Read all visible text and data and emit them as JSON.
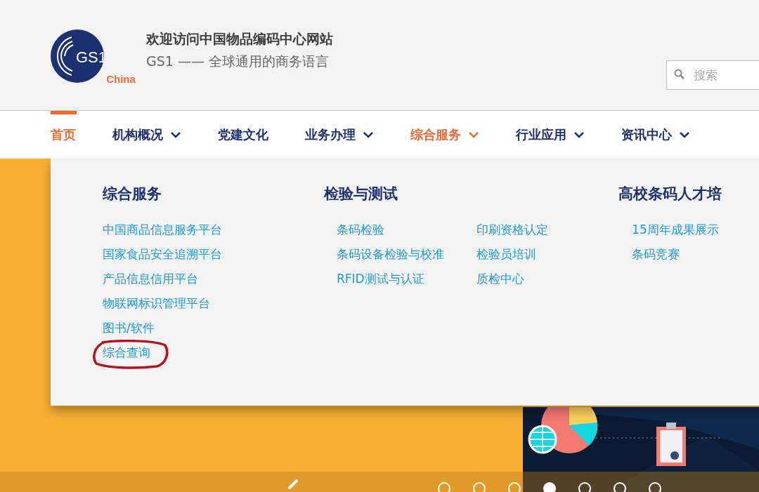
{
  "logo": {
    "mark": "GS1",
    "region": "China"
  },
  "header": {
    "title": "欢迎访问中国物品编码中心网站",
    "slogan": "GS1 —— 全球通用的商务语言"
  },
  "search": {
    "placeholder": "搜索"
  },
  "nav": [
    {
      "label": "首页",
      "selected": true,
      "expanded": false,
      "has_menu": false
    },
    {
      "label": "机构概况",
      "selected": false,
      "expanded": false,
      "has_menu": true
    },
    {
      "label": "党建文化",
      "selected": false,
      "expanded": false,
      "has_menu": false
    },
    {
      "label": "业务办理",
      "selected": false,
      "expanded": false,
      "has_menu": true
    },
    {
      "label": "综合服务",
      "selected": false,
      "expanded": true,
      "has_menu": true
    },
    {
      "label": "行业应用",
      "selected": false,
      "expanded": false,
      "has_menu": true
    },
    {
      "label": "资讯中心",
      "selected": false,
      "expanded": false,
      "has_menu": true
    }
  ],
  "dropdown": {
    "sections": [
      {
        "heading": "综合服务",
        "columns": [
          [
            "中国商品信息服务平台",
            "国家食品安全追溯平台",
            "产品信息信用平台",
            "物联网标识管理平台",
            "图书/软件",
            "综合查询"
          ]
        ]
      },
      {
        "heading": "检验与测试",
        "columns": [
          [
            "条码检验",
            "条码设备检验与校准",
            "RFID测试与认证"
          ],
          [
            "印刷资格认定",
            "检验员培训",
            "质检中心"
          ]
        ]
      },
      {
        "heading": "高校条码人才培",
        "columns": [
          [
            "15周年成果展示",
            "条码竞赛"
          ]
        ]
      }
    ]
  },
  "carousel": {
    "dots": [
      {
        "selected": false
      },
      {
        "selected": false
      },
      {
        "selected": false
      },
      {
        "selected": true
      },
      {
        "selected": false
      },
      {
        "selected": false
      },
      {
        "selected": false
      }
    ]
  }
}
